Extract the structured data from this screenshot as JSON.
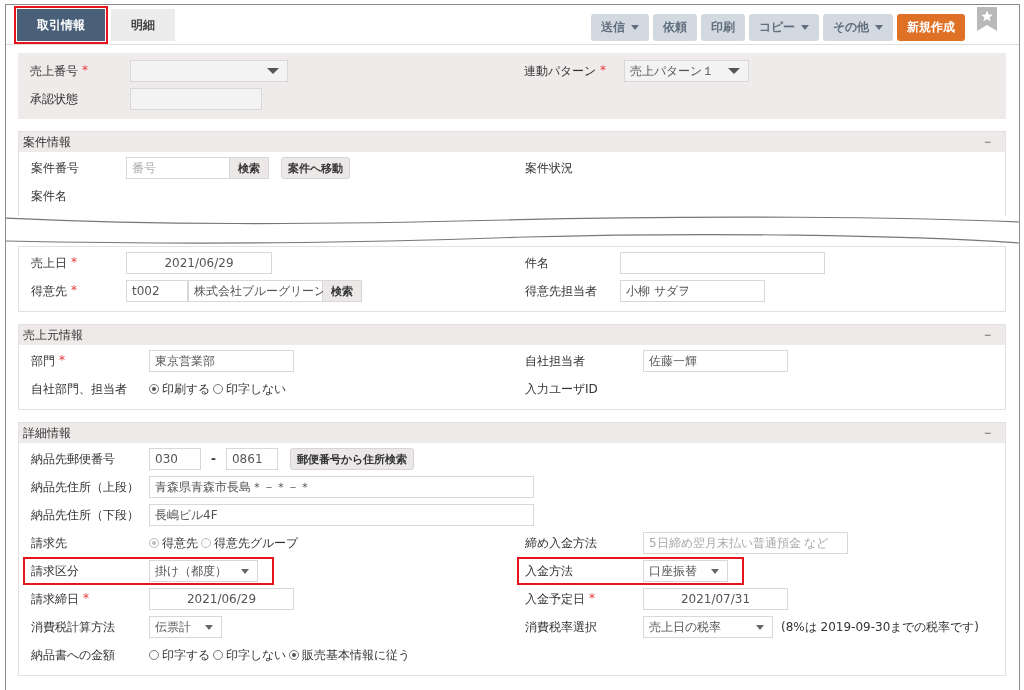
{
  "tabs": [
    {
      "label": "取引情報",
      "selected": true,
      "highlighted": true
    },
    {
      "label": "明細",
      "selected": false
    }
  ],
  "toolbar": [
    {
      "label": "送信",
      "kind": "secondary",
      "disabled": true,
      "dropdown": true
    },
    {
      "label": "依頼",
      "kind": "secondary",
      "disabled": true
    },
    {
      "label": "印刷",
      "kind": "secondary",
      "disabled": true
    },
    {
      "label": "コピー",
      "kind": "secondary",
      "disabled": true,
      "dropdown": true
    },
    {
      "label": "その他",
      "kind": "secondary",
      "disabled": true,
      "dropdown": true
    },
    {
      "label": "新規作成",
      "kind": "primary"
    }
  ],
  "sections": [
    {
      "kind": "panel",
      "rows": [
        {
          "left": {
            "label": "売上番号",
            "required_mark": "*",
            "control": {
              "kind": "select"
            }
          },
          "right": {
            "label": "連動パターン",
            "required_mark": "*",
            "control": {
              "kind": "select",
              "value": "売上パターン１"
            }
          }
        },
        {
          "left": {
            "label": "承認状態",
            "control": {
              "kind": "text"
            }
          }
        }
      ]
    },
    {
      "kind": "card",
      "title": "案件情報",
      "toggle": "−",
      "cut_below": true,
      "rows": [
        {
          "left": {
            "label": "案件番号",
            "control": {
              "kind": "search",
              "inputs": [
                {
                  "placeholder": "番号"
                }
              ],
              "buttons": [
                {
                  "label": "検索",
                  "attached": true
                },
                {
                  "label": "案件へ移動"
                }
              ]
            }
          },
          "right": {
            "label": "案件状況"
          }
        },
        {
          "left": {
            "label": "案件名"
          }
        }
      ]
    },
    {
      "kind": "card",
      "rows": [
        {
          "left": {
            "label": "売上日",
            "required_mark": "*",
            "control": {
              "kind": "date",
              "value": "2021/06/29"
            }
          },
          "right": {
            "label": "件名",
            "control": {
              "kind": "text"
            }
          }
        },
        {
          "left": {
            "label": "得意先",
            "required_mark": "*",
            "control": {
              "kind": "search",
              "inputs": [
                {
                  "value": "t002"
                },
                {
                  "value": "株式会社ブルーグリーン"
                }
              ],
              "buttons": [
                {
                  "label": "検索",
                  "attached": true
                }
              ]
            }
          },
          "right": {
            "label": "得意先担当者",
            "control": {
              "kind": "text",
              "value": "小柳 サダヲ"
            }
          }
        }
      ]
    },
    {
      "kind": "card",
      "title": "売上元情報",
      "toggle": "−",
      "rows": [
        {
          "left": {
            "label": "部門",
            "required_mark": "*",
            "control": {
              "kind": "text",
              "value": "東京営業部"
            }
          },
          "right": {
            "label": "自社担当者",
            "control": {
              "kind": "text",
              "value": "佐藤一輝"
            }
          }
        },
        {
          "left": {
            "label": "自社部門、担当者",
            "control": {
              "kind": "radio",
              "options": [
                {
                  "label": "印刷する",
                  "selected": true
                },
                {
                  "label": "印字しない",
                  "selected": false
                }
              ]
            }
          },
          "right": {
            "label": "入力ユーザID"
          }
        }
      ]
    },
    {
      "kind": "card",
      "title": "詳細情報",
      "toggle": "−",
      "rows": [
        {
          "left": {
            "label": "納品先郵便番号",
            "control": {
              "kind": "postal",
              "parts": [
                "030",
                "0861"
              ],
              "separator": "-",
              "button": "郵便番号から住所検索"
            }
          }
        },
        {
          "left": {
            "label": "納品先住所（上段）",
            "control": {
              "kind": "text",
              "value": "青森県青森市長島＊－＊－＊"
            }
          }
        },
        {
          "left": {
            "label": "納品先住所（下段）",
            "control": {
              "kind": "text",
              "value": "長嶋ビル4F"
            }
          }
        },
        {
          "left": {
            "label": "請求先",
            "control": {
              "kind": "radio",
              "disabled": true,
              "options": [
                {
                  "label": "得意先",
                  "selected": true
                },
                {
                  "label": "得意先グループ",
                  "selected": false
                }
              ]
            }
          },
          "right": {
            "label": "締め入金方法",
            "control": {
              "kind": "text",
              "placeholder": "5日締め翌月末払い普通預金 など"
            }
          }
        },
        {
          "left": {
            "label": "請求区分",
            "highlighted": true,
            "control": {
              "kind": "select",
              "value": "掛け（都度）"
            }
          },
          "right": {
            "label": "入金方法",
            "highlighted": true,
            "control": {
              "kind": "select",
              "value": "口座振替"
            }
          }
        },
        {
          "left": {
            "label": "請求締日",
            "required_mark": "*",
            "control": {
              "kind": "date",
              "value": "2021/06/29"
            }
          },
          "right": {
            "label": "入金予定日",
            "required_mark": "*",
            "control": {
              "kind": "date",
              "value": "2021/07/31"
            }
          }
        },
        {
          "left": {
            "label": "消費税計算方法",
            "control": {
              "kind": "select",
              "value": "伝票計"
            }
          },
          "right": {
            "label": "消費税率選択",
            "control": {
              "kind": "select",
              "value": "売上日の税率",
              "note": "(8%は 2019-09-30までの税率です)"
            }
          }
        },
        {
          "left": {
            "label": "納品書への金額",
            "control": {
              "kind": "radio",
              "options": [
                {
                  "label": "印字する",
                  "selected": false
                },
                {
                  "label": "印字しない",
                  "selected": false
                },
                {
                  "label": "販売基本情報に従う",
                  "selected": true
                }
              ]
            }
          }
        }
      ]
    }
  ]
}
